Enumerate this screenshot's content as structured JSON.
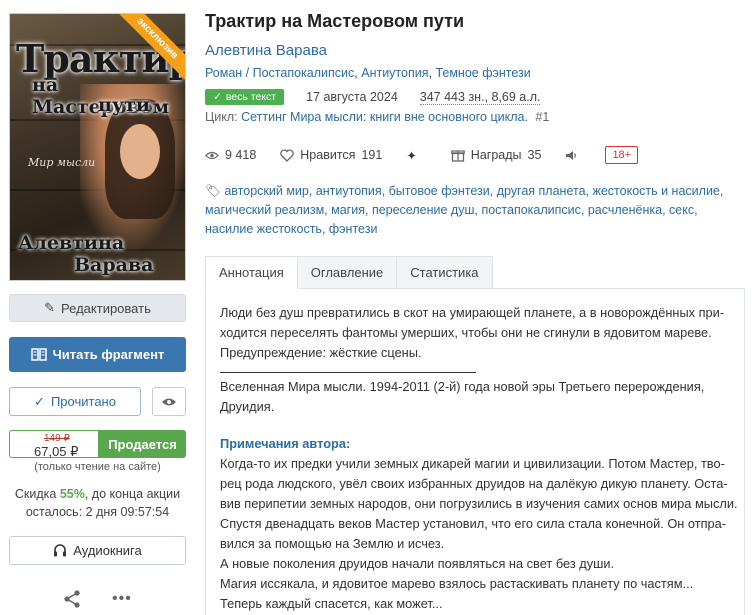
{
  "book": {
    "title": "Трактир на Мастеровом пути",
    "author": "Алевтина Варава",
    "genres": [
      "Роман / Постапокалипсис",
      "Антиутопия",
      "Темное фэнтези"
    ],
    "status_badge": "весь текст",
    "date": "17 августа 2024",
    "size": "347 443 зн., 8,69 а.л.",
    "cycle_label": "Цикл:",
    "cycle_name": "Сеттинг Мира мысли: книги вне основного цикла.",
    "cycle_number": "#1"
  },
  "cover": {
    "ribbon": "эксклюзив",
    "title_line1": "Трактир",
    "title_line2": "на Мастеровом",
    "title_line3": "пути",
    "series": "Мир мысли",
    "author_line1": "Алевтина",
    "author_line2": "Варава"
  },
  "stats": {
    "views": "9 418",
    "likes_label": "Нравится",
    "likes": "191",
    "awards_label": "Награды",
    "awards": "35",
    "age_rating": "18+"
  },
  "tags": [
    "авторский мир",
    "антиутопия",
    "бытовое фэнтези",
    "другая планета",
    "жестокость и насилие",
    "магический реализм",
    "магия",
    "переселение душ",
    "постапокалипсис",
    "расчленёнка",
    "секс",
    "насилие жестокость",
    "фэнтези"
  ],
  "tabs": [
    "Аннотация",
    "Оглавление",
    "Статистика"
  ],
  "annotation": {
    "lines": [
      "Люди без душ превратились в скот на умирающей планете, а в новорождённых при-",
      "ходится переселять фантомы умерших, чтобы они не сгинули в ядовитом мареве.",
      "Предупреждение: жёсткие сцены."
    ],
    "universe": [
      "Вселенная Мира мысли. 1994-2011 (2-й) года новой эры Третьего перерождения,",
      "Друидия."
    ],
    "notes_heading": "Примечания автора:",
    "notes": [
      "Когда-то их предки учили земных дикарей магии и цивилизации. Потом Мастер, тво-",
      "рец рода людского, увёл своих избранных друидов на далёкую дикую планету. Оста-",
      "вив перипетии земных народов, они погрузились в изучения самих основ мира мысли.",
      "Спустя двенадцать веков Мастер установил, что его сила стала конечной. Он отпра-",
      "вился за помощью на Землю и исчез.",
      "А новые поколения друидов начали появляться на свет без души.",
      "Магия иссякала, и ядовитое марево взялось растаскивать планету по частям...",
      "Теперь каждый спасется, как может..."
    ]
  },
  "sidebar": {
    "edit_label": "Редактировать",
    "read_fragment_label": "Читать фрагмент",
    "read_done_label": "Прочитано",
    "price_old": "149 ₽",
    "price_new": "67,05 ₽",
    "buy_label": "Продается",
    "site_only_note": "(только чтение на сайте)",
    "discount_prefix": "Скидка",
    "discount_pct": "55%",
    "discount_suffix": ", до конца акции",
    "time_left": "осталось: 2 дня 09:57:54",
    "audiobook_label": "Аудиокнига"
  },
  "colors": {
    "accent": "#3a76b0",
    "link": "#2d6ca2",
    "buy": "#5aa84e",
    "ribbon": "#f5a01a",
    "age": "#dd3333"
  }
}
